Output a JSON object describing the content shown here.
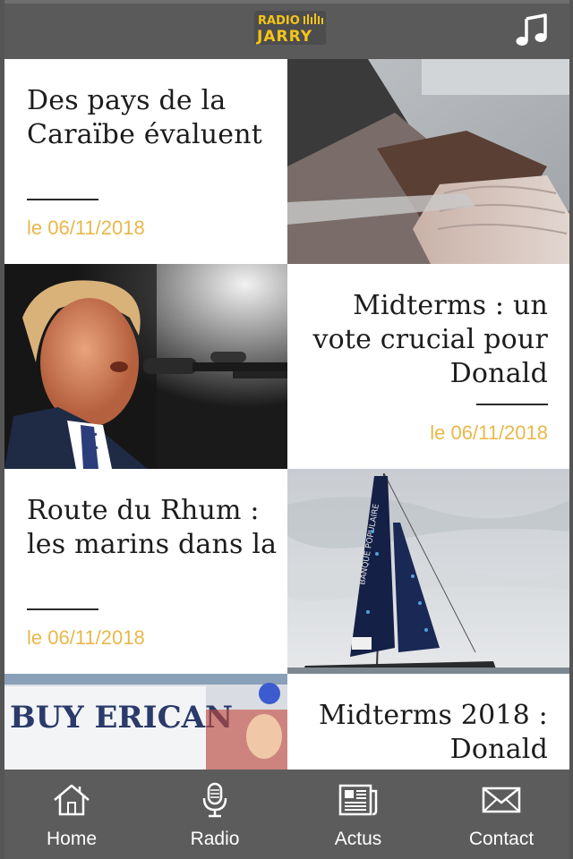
{
  "header": {
    "logo_line1": "RADIO",
    "logo_line2": "JARRY",
    "music_icon": "music-note-icon"
  },
  "articles": [
    {
      "title": "Des pays de la Caraïbe évaluent",
      "date": "le 06/11/2018",
      "image": "fish-cutting-photo"
    },
    {
      "title": "Midterms : un vote crucial pour Donald",
      "date": "le 06/11/2018",
      "image": "speaker-at-microphone-photo"
    },
    {
      "title": "Route du Rhum : les marins dans la",
      "date": "le 06/11/2018",
      "image": "sailboat-photo"
    },
    {
      "title": "Midterms 2018 : Donald",
      "date": "",
      "image": "rally-crowd-photo",
      "image_text": "BUY ERICAN"
    }
  ],
  "tabs": [
    {
      "label": "Home",
      "icon": "home-icon"
    },
    {
      "label": "Radio",
      "icon": "microphone-icon"
    },
    {
      "label": "Actus",
      "icon": "newspaper-icon"
    },
    {
      "label": "Contact",
      "icon": "envelope-icon"
    }
  ],
  "colors": {
    "header_bg": "#5a5a5a",
    "tabbar_bg": "#5c5c5c",
    "date_color": "#e8b84a",
    "logo_yellow": "#f5c518"
  }
}
